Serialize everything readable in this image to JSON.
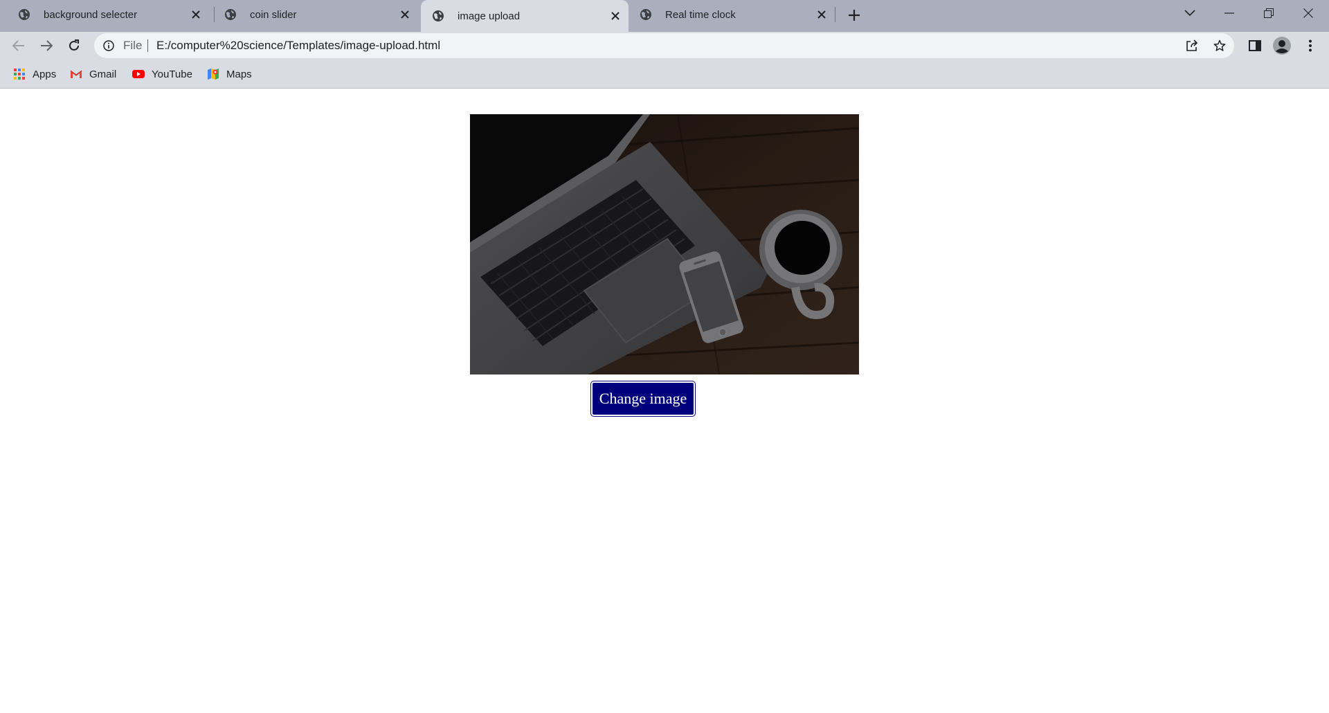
{
  "browser": {
    "tabs": [
      {
        "title": "background selecter",
        "active": false
      },
      {
        "title": "coin slider",
        "active": false
      },
      {
        "title": "image upload",
        "active": true
      },
      {
        "title": "Real time clock",
        "active": false
      }
    ],
    "address_bar": {
      "scheme_label": "File",
      "url": "E:/computer%20science/Templates/image-upload.html"
    },
    "bookmarks": [
      {
        "label": "Apps",
        "icon": "apps-grid-icon"
      },
      {
        "label": "Gmail",
        "icon": "gmail-icon"
      },
      {
        "label": "YouTube",
        "icon": "youtube-icon"
      },
      {
        "label": "Maps",
        "icon": "maps-icon"
      }
    ],
    "colors": {
      "tabstrip": "#a9afbc",
      "toolbar": "#dadce3",
      "omnibox": "#f1f3f4"
    }
  },
  "page": {
    "image": {
      "subject": "laptop-phone-coffee-photo"
    },
    "change_button": {
      "label": "Change image",
      "color": "#00007d"
    }
  }
}
